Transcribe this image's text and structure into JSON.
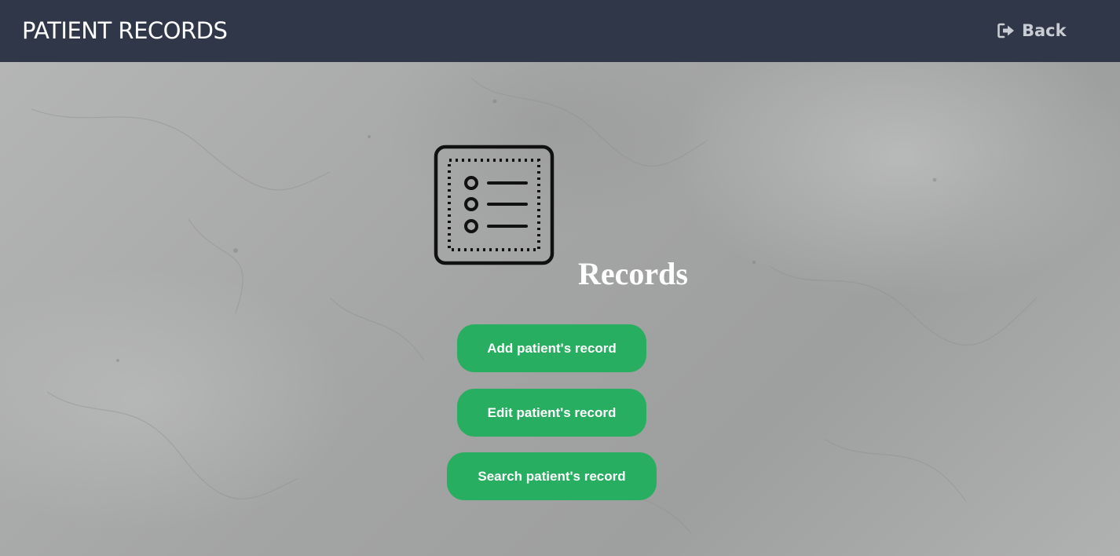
{
  "header": {
    "title": "PATIENT RECORDS",
    "back_label": "Back",
    "back_icon": "sign-out-icon",
    "background_color": "#2f3749"
  },
  "main": {
    "icon": "records-list-icon",
    "heading": "Records",
    "actions": [
      {
        "label": "Add patient's record"
      },
      {
        "label": "Edit patient's record"
      },
      {
        "label": "Search patient's record"
      }
    ],
    "button_color": "#27ae60"
  }
}
